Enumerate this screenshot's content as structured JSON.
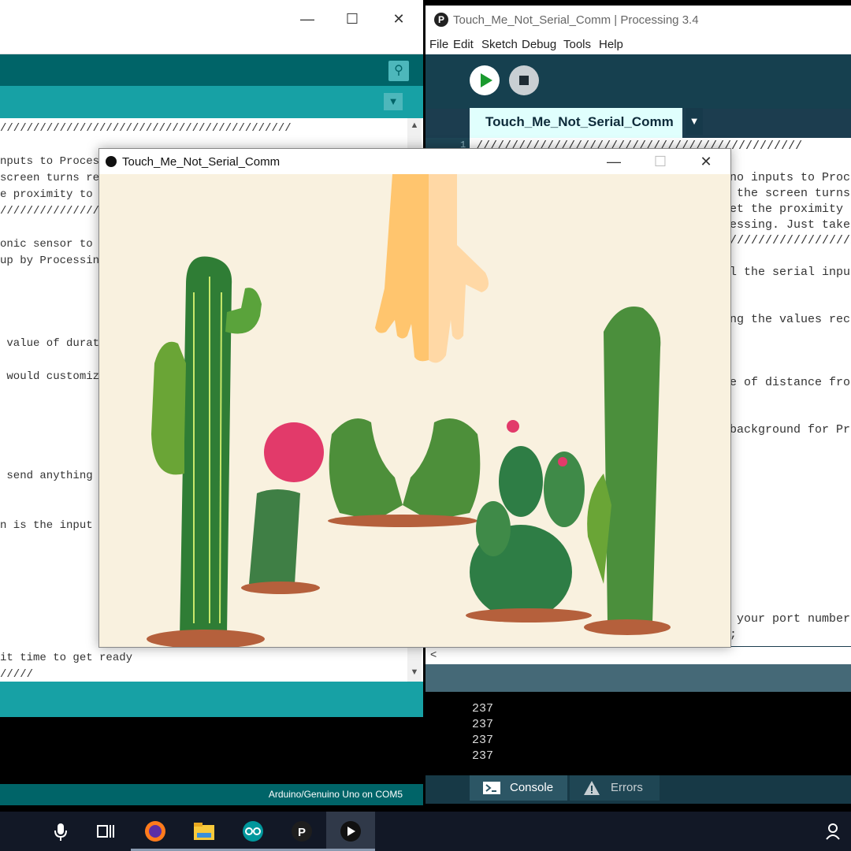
{
  "arduino": {
    "code_lines": [
      "////////////////////////////////////////////",
      "",
      "nputs to Processing, the",
      "screen turns red",
      "e proximity to the sensor",
      "/////////////////////////",
      "",
      "onic sensor to",
      "up by Processing",
      "",
      "",
      "",
      " value of duration",
      "",
      " would customize",
      "",
      "",
      "",
      "",
      "",
      " send anything",
      "",
      "",
      "n is the input",
      "",
      "",
      "",
      "",
      "",
      "",
      "",
      "",
      "",
      "it time to get ready",
      "/////"
    ],
    "board_status": "Arduino/Genuino Uno on COM5"
  },
  "processing": {
    "window_title": "Touch_Me_Not_Serial_Comm | Processing 3.4",
    "menu": [
      "File",
      "Edit",
      "Sketch",
      "Debug",
      "Tools",
      "Help"
    ],
    "tab_label": "Touch_Me_Not_Serial_Comm",
    "line_number": "1",
    "code_lines": [
      "//////////////////////////////////////////////",
      "no inputs to Proc",
      " the screen turns",
      "et the proximity",
      "essing. Just take",
      "//////////////////",
      "l the serial inpu",
      "ng the values rec",
      "e of distance fro",
      "background for Pr",
      " your port number",
      ";"
    ],
    "console_lines": [
      "237",
      "237",
      "237",
      "237"
    ],
    "console_tab": "Console",
    "errors_tab": "Errors"
  },
  "sketch": {
    "window_title": "Touch_Me_Not_Serial_Comm",
    "background_color": "#f9f1df"
  },
  "taskbar": {
    "items": [
      "microphone-icon",
      "task-view-icon",
      "firefox-icon",
      "file-explorer-icon",
      "arduino-icon",
      "processing-icon",
      "sketch-app-icon"
    ]
  }
}
